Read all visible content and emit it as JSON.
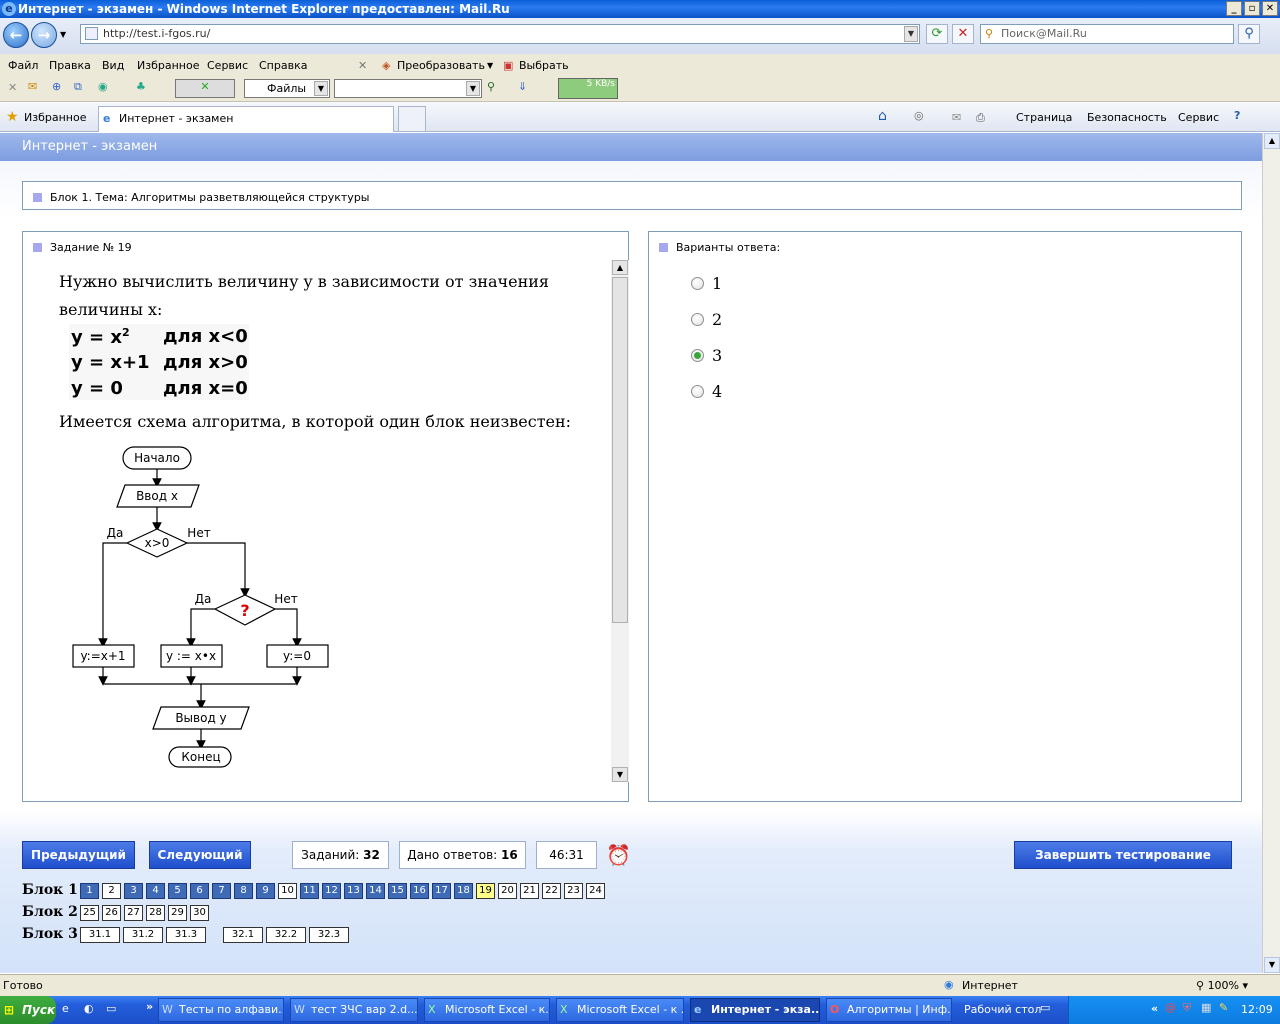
{
  "window": {
    "title": "Интернет - экзамен - Windows Internet Explorer предоставлен: Mail.Ru",
    "buttons": [
      "_",
      "▫",
      "✕"
    ]
  },
  "address": {
    "url": "http://test.i-fgos.ru/",
    "search_placeholder": "Поиск@Mail.Ru"
  },
  "menu": {
    "items": [
      "Файл",
      "Правка",
      "Вид",
      "Избранное",
      "Сервис",
      "Справка"
    ],
    "convert": "Преобразовать",
    "select": "Выбрать"
  },
  "toolbar": {
    "files": "Файлы",
    "speed": "5 KB/s"
  },
  "tabs": {
    "favorites": "Избранное",
    "tab_title": "Интернет - экзамен"
  },
  "commands": {
    "page": "Страница",
    "safety": "Безопасность",
    "service": "Сервис"
  },
  "page": {
    "header": "Интернет - экзамен",
    "block_title": "Блок 1. Тема: Алгоритмы разветвляющейся структуры",
    "task_title": "Задание № 19",
    "answers_title": "Варианты ответа:",
    "question_line1": "Нужно вычислить величину y в зависимости от значения",
    "question_line2": "величины x:",
    "formulas": [
      {
        "expr": "y = x",
        "sup": "2",
        "cond": "для x<0"
      },
      {
        "expr": "y = x+1",
        "sup": "",
        "cond": "для x>0"
      },
      {
        "expr": "y = 0",
        "sup": "",
        "cond": "для x=0"
      }
    ],
    "question_line3": "Имеется схема алгоритма, в которой один блок неизвестен:",
    "flowchart": {
      "start": "Начало",
      "input": "Ввод x",
      "cond1": "x>0",
      "yes": "Да",
      "no": "Нет",
      "cond2": "?",
      "box1": "y:=x+1",
      "box2": "y := x•x",
      "box3": "y:=0",
      "output": "Вывод  y",
      "end": "Конец"
    },
    "options": [
      "1",
      "2",
      "3",
      "4"
    ],
    "selected_option": "3"
  },
  "controls": {
    "prev": "Предыдущий",
    "next": "Следующий",
    "tasks_label": "Заданий:",
    "tasks_count": "32",
    "answered_label": "Дано ответов:",
    "answered_count": "16",
    "timer": "46:31",
    "finish": "Завершить тестирование"
  },
  "blocks": [
    {
      "label": "Блок 1",
      "items": [
        "1",
        "2",
        "3",
        "4",
        "5",
        "6",
        "7",
        "8",
        "9",
        "10",
        "11",
        "12",
        "13",
        "14",
        "15",
        "16",
        "17",
        "18",
        "19",
        "20",
        "21",
        "22",
        "23",
        "24"
      ],
      "answered": [
        "1",
        "3",
        "4",
        "5",
        "6",
        "7",
        "8",
        "9",
        "11",
        "12",
        "13",
        "14",
        "15",
        "16",
        "17",
        "18"
      ],
      "current": "19"
    },
    {
      "label": "Блок 2",
      "items": [
        "25",
        "26",
        "27",
        "28",
        "29",
        "30"
      ],
      "answered": [],
      "current": ""
    },
    {
      "label": "Блок 3",
      "items": [
        "31.1",
        "31.2",
        "31.3",
        "32.1",
        "32.2",
        "32.3"
      ],
      "answered": [],
      "current": ""
    }
  ],
  "status": {
    "text": "Готово",
    "zone": "Интернет",
    "zoom": "100%"
  },
  "taskbar": {
    "start": "Пуск",
    "tasks": [
      "Тесты по алфави...",
      "тест ЗЧС вар 2.d...",
      "Microsoft Excel - к...",
      "Microsoft Excel - к ...",
      "Интернет - экза...",
      "Алгоритмы | Инф..."
    ],
    "desktop": "Рабочий стол",
    "lang": "RU",
    "clock": "12:09"
  }
}
